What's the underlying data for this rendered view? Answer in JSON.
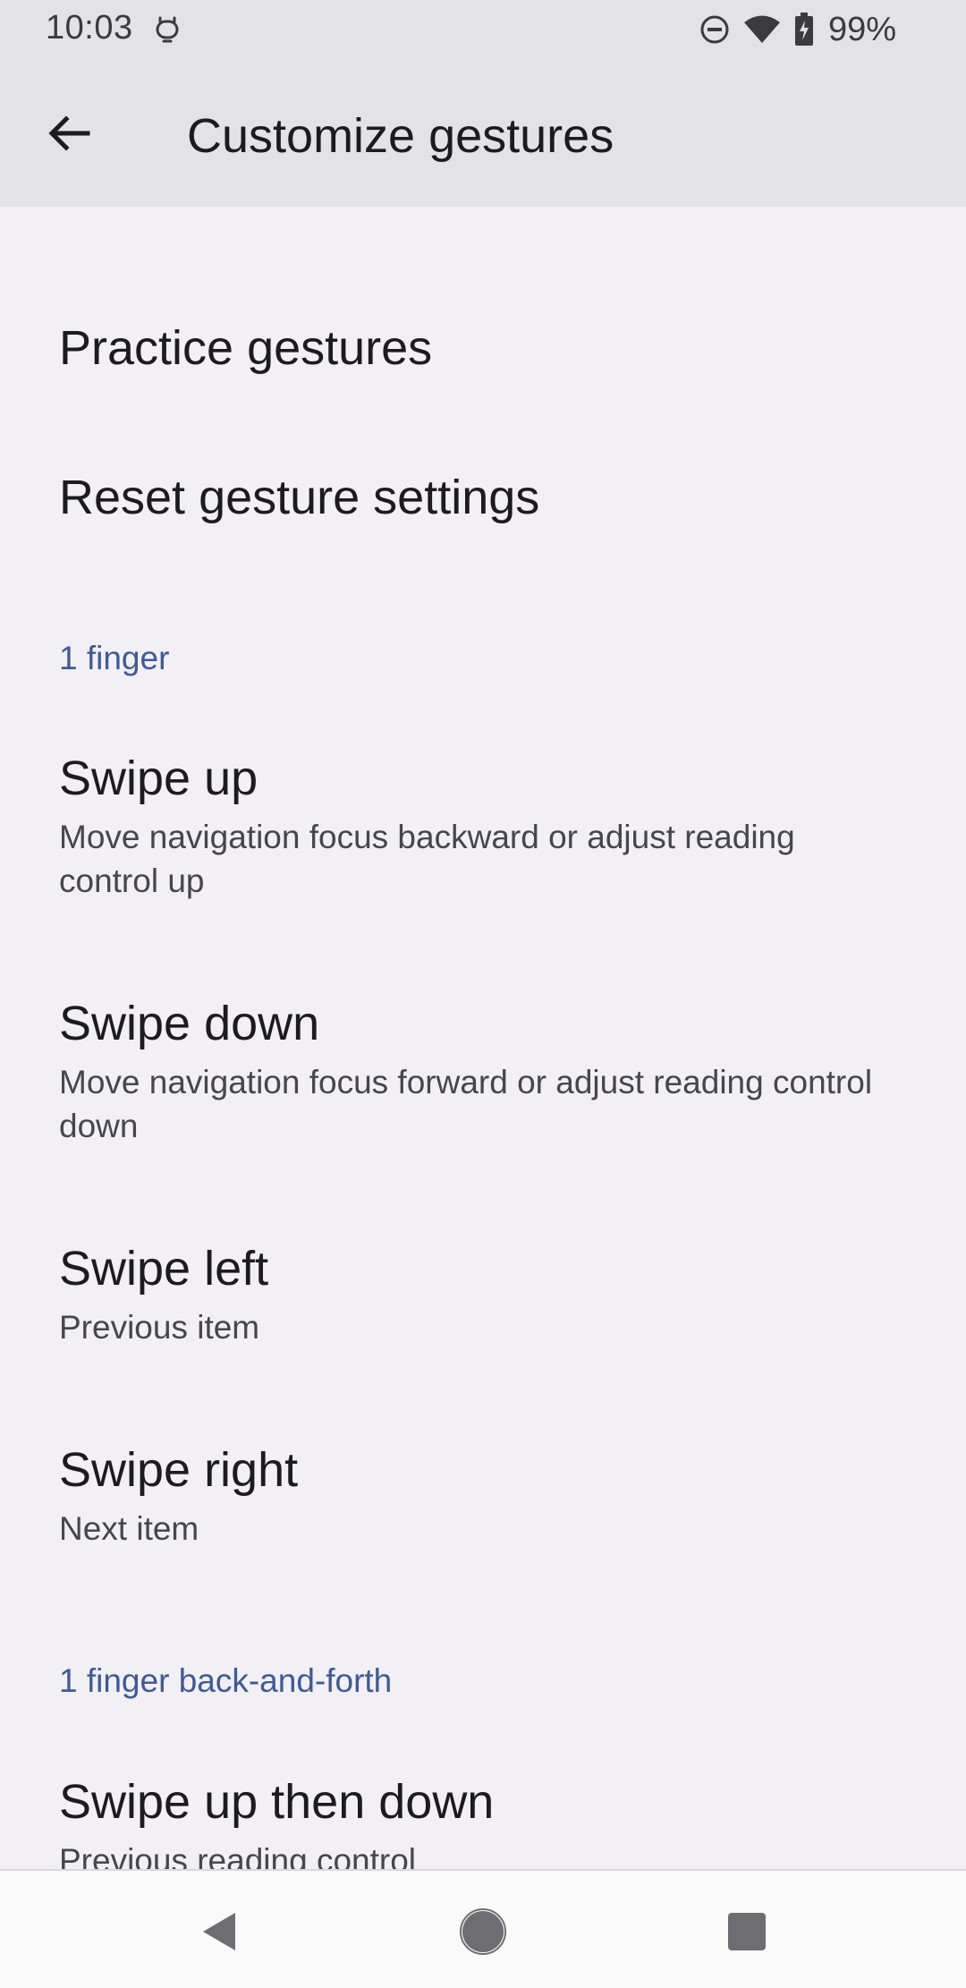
{
  "status_bar": {
    "time": "10:03",
    "battery": "99%",
    "left_icon": "notification-bell-icon",
    "right_icons": [
      "do-not-disturb-icon",
      "wifi-icon",
      "battery-charging-icon"
    ]
  },
  "app_bar": {
    "title": "Customize gestures",
    "back_icon": "arrow-back-icon"
  },
  "items": {
    "practice": "Practice gestures",
    "reset": "Reset gesture settings"
  },
  "sections": [
    {
      "header": "1 finger",
      "prefs": [
        {
          "title": "Swipe up",
          "summary": "Move navigation focus backward or adjust reading control up"
        },
        {
          "title": "Swipe down",
          "summary": "Move navigation focus forward or adjust reading control down"
        },
        {
          "title": "Swipe left",
          "summary": "Previous item"
        },
        {
          "title": "Swipe right",
          "summary": "Next item"
        }
      ]
    },
    {
      "header": "1 finger back-and-forth",
      "prefs": [
        {
          "title": "Swipe up then down",
          "summary": "Previous reading control"
        }
      ]
    }
  ],
  "nav_bar": {
    "back": "nav-back-icon",
    "home": "nav-home-icon",
    "recents": "nav-recents-icon"
  },
  "colors": {
    "background": "#f2f0f4",
    "app_bar": "#e3e2e6",
    "section_header": "#3d5a98"
  }
}
